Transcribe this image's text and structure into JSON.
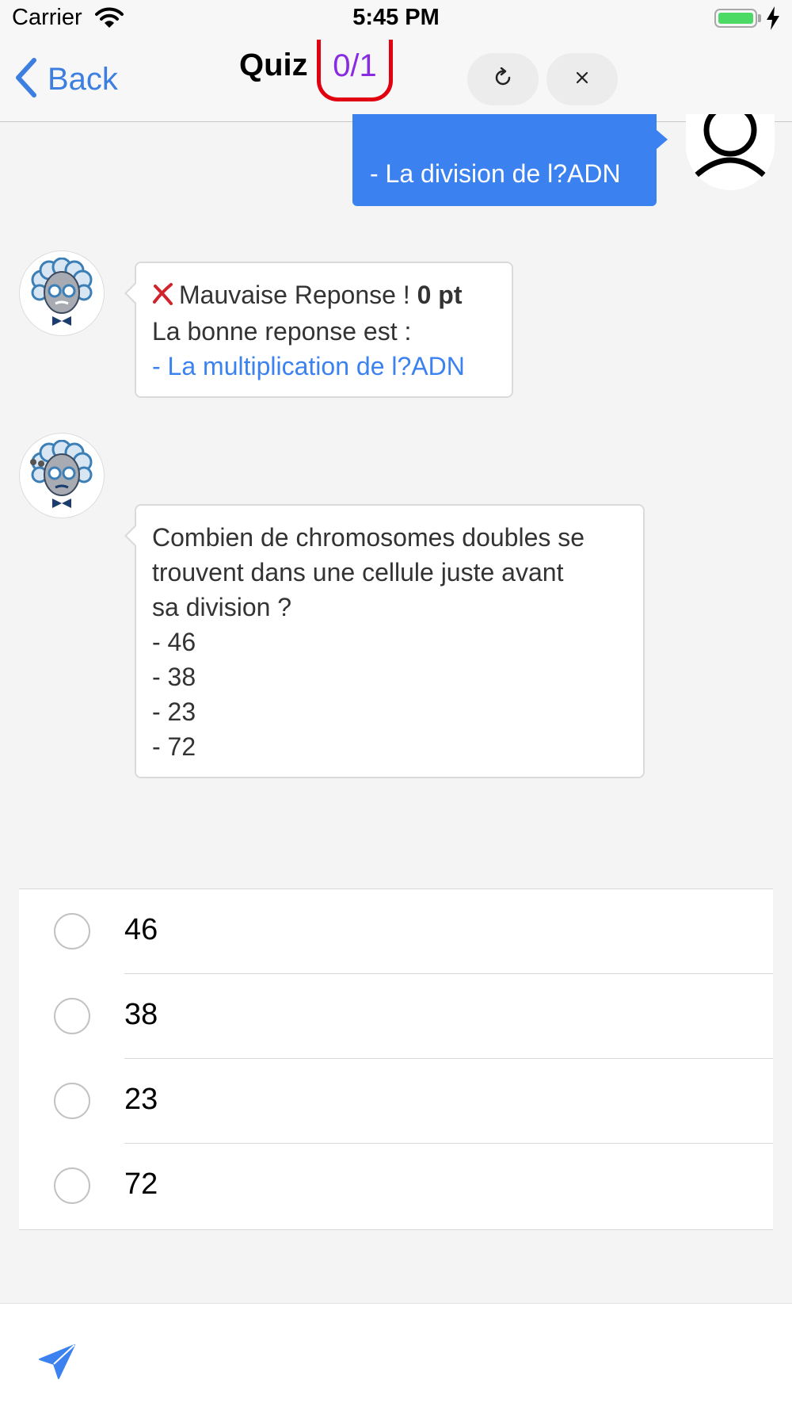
{
  "status_bar": {
    "carrier": "Carrier",
    "time": "5:45 PM",
    "battery_color": "#4cd964"
  },
  "nav": {
    "back_label": "Back",
    "title": "Quiz",
    "score": "0/1",
    "score_color": "#8a2be2",
    "score_ring_color": "#e0000f",
    "refresh_icon": "refresh-icon",
    "close_icon": "close-icon"
  },
  "chat": {
    "user_message": "- La division de l?ADN",
    "feedback": {
      "icon": "wrong-x-icon",
      "text": "Mauvaise Reponse !",
      "points": "0 pt",
      "correct_intro": "La bonne reponse est :",
      "correct_answer": "- La multiplication de l?ADN"
    },
    "question": {
      "lines": [
        "Combien de chromosomes doubles se",
        "trouvent dans une cellule juste avant",
        "sa division ?",
        "- 46",
        "- 38",
        "- 23",
        "- 72"
      ]
    }
  },
  "answers": [
    "46",
    "38",
    "23",
    "72"
  ],
  "accent_color": "#3b82f0",
  "send_icon": "send-icon"
}
